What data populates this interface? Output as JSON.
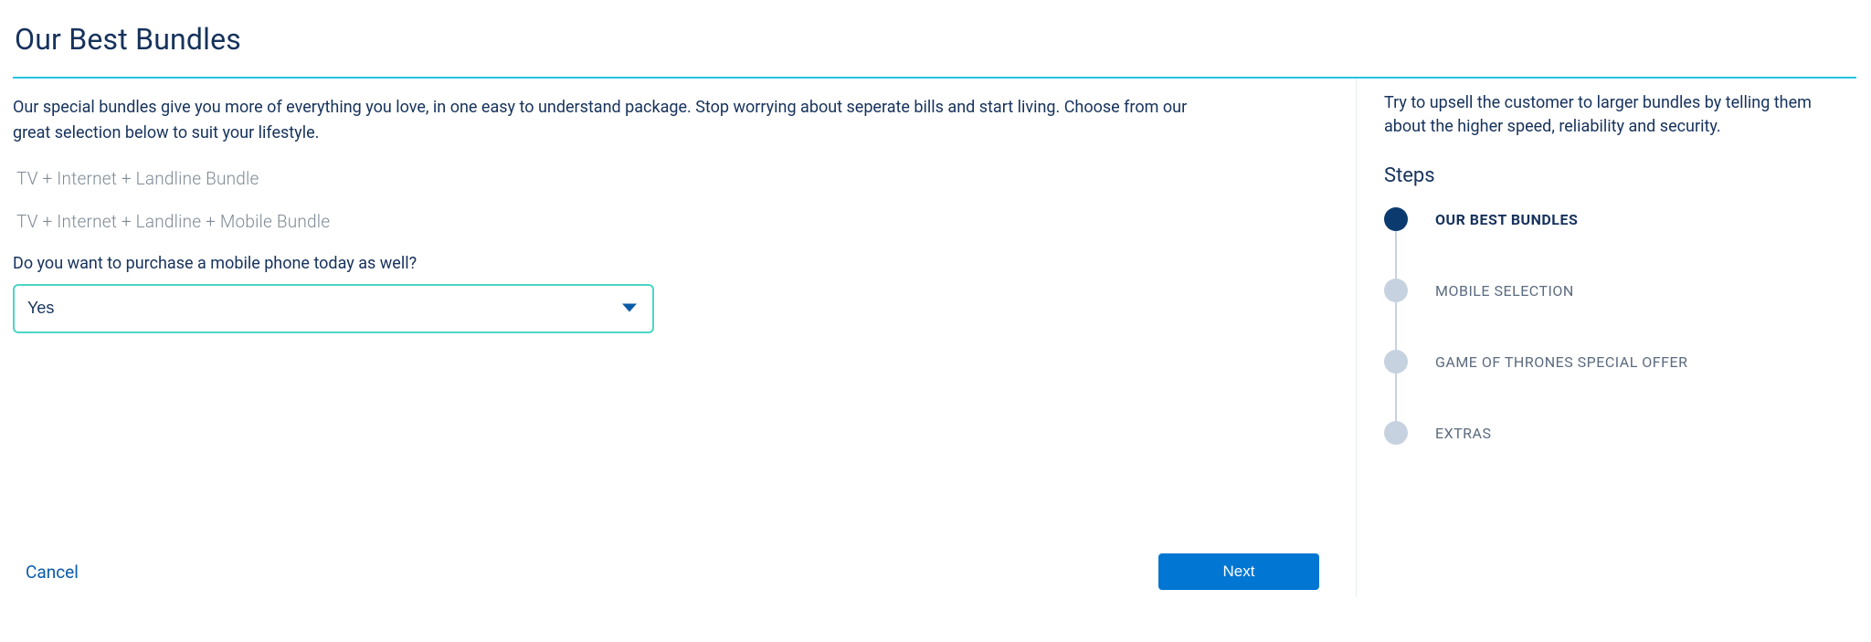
{
  "header": {
    "title": "Our Best Bundles"
  },
  "main": {
    "intro": "Our special bundles give you more of everything you love, in one easy to understand package. Stop worrying about seperate bills and start living. Choose from our great selection below to suit your lifestyle.",
    "options": [
      "TV + Internet + Landline Bundle",
      "TV + Internet + Landline + Mobile Bundle"
    ],
    "question": "Do you want to purchase a mobile phone today as well?",
    "select": {
      "value": "Yes"
    },
    "actions": {
      "cancel": "Cancel",
      "next": "Next"
    }
  },
  "sidebar": {
    "tip": "Try to upsell the customer to larger bundles by telling them about the higher speed, reliability and security.",
    "stepsTitle": "Steps",
    "steps": [
      {
        "label": "OUR BEST BUNDLES",
        "active": true
      },
      {
        "label": "MOBILE SELECTION",
        "active": false
      },
      {
        "label": "GAME OF THRONES SPECIAL OFFER",
        "active": false
      },
      {
        "label": "EXTRAS",
        "active": false
      }
    ]
  },
  "colors": {
    "accentBorder": "#4bd6c6",
    "hr": "#25c3e6",
    "primary": "#0176d3",
    "stepActive": "#0b3a6f",
    "stepInactive": "#c7d2e0"
  }
}
